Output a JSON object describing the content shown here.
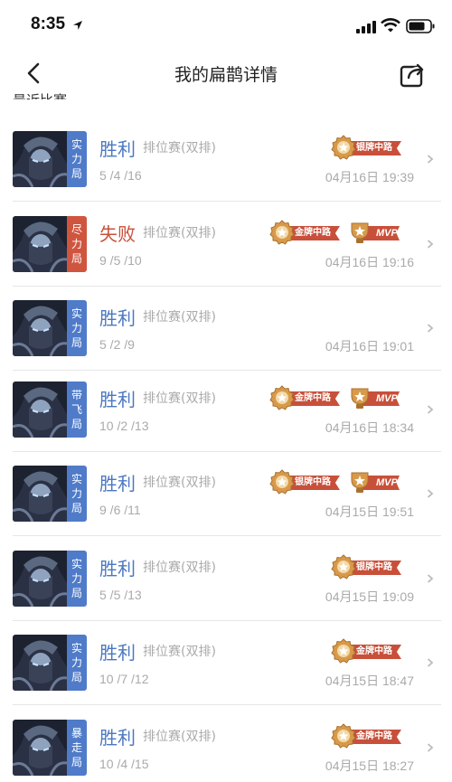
{
  "status_bar": {
    "time": "8:35"
  },
  "nav": {
    "title": "我的扁鹊详情"
  },
  "section_title": "最近比赛",
  "colors": {
    "win": "#4a78c2",
    "lose": "#c8503a",
    "tag_blue": "#4f7bc9",
    "tag_red": "#d0553f",
    "medal_gold": "#d89a4a",
    "ribbon": "#c8503a"
  },
  "matches": [
    {
      "tag_chars": [
        "实",
        "力",
        "局"
      ],
      "tag_color": "blue",
      "result": "胜利",
      "outcome": "win",
      "type": "排位赛(双排)",
      "kda": "5 /4 /16",
      "date": "04月16日 19:39",
      "badges": [
        {
          "label": "银牌中路",
          "kind": "medal"
        }
      ]
    },
    {
      "tag_chars": [
        "尽",
        "力",
        "局"
      ],
      "tag_color": "red",
      "result": "失败",
      "outcome": "lose",
      "type": "排位赛(双排)",
      "kda": "9 /5 /10",
      "date": "04月16日 19:16",
      "badges": [
        {
          "label": "金牌中路",
          "kind": "medal"
        },
        {
          "label": "MVP",
          "kind": "mvp"
        }
      ]
    },
    {
      "tag_chars": [
        "实",
        "力",
        "局"
      ],
      "tag_color": "blue",
      "result": "胜利",
      "outcome": "win",
      "type": "排位赛(双排)",
      "kda": "5 /2 /9",
      "date": "04月16日 19:01",
      "badges": []
    },
    {
      "tag_chars": [
        "带",
        "飞",
        "局"
      ],
      "tag_color": "blue",
      "result": "胜利",
      "outcome": "win",
      "type": "排位赛(双排)",
      "kda": "10 /2 /13",
      "date": "04月16日 18:34",
      "badges": [
        {
          "label": "金牌中路",
          "kind": "medal"
        },
        {
          "label": "MVP",
          "kind": "mvp"
        }
      ]
    },
    {
      "tag_chars": [
        "实",
        "力",
        "局"
      ],
      "tag_color": "blue",
      "result": "胜利",
      "outcome": "win",
      "type": "排位赛(双排)",
      "kda": "9 /6 /11",
      "date": "04月15日 19:51",
      "badges": [
        {
          "label": "银牌中路",
          "kind": "medal"
        },
        {
          "label": "MVP",
          "kind": "mvp"
        }
      ]
    },
    {
      "tag_chars": [
        "实",
        "力",
        "局"
      ],
      "tag_color": "blue",
      "result": "胜利",
      "outcome": "win",
      "type": "排位赛(双排)",
      "kda": "5 /5 /13",
      "date": "04月15日 19:09",
      "badges": [
        {
          "label": "银牌中路",
          "kind": "medal"
        }
      ]
    },
    {
      "tag_chars": [
        "实",
        "力",
        "局"
      ],
      "tag_color": "blue",
      "result": "胜利",
      "outcome": "win",
      "type": "排位赛(双排)",
      "kda": "10 /7 /12",
      "date": "04月15日 18:47",
      "badges": [
        {
          "label": "金牌中路",
          "kind": "medal"
        }
      ]
    },
    {
      "tag_chars": [
        "暴",
        "走",
        "局"
      ],
      "tag_color": "blue",
      "result": "胜利",
      "outcome": "win",
      "type": "排位赛(双排)",
      "kda": "10 /4 /15",
      "date": "04月15日 18:27",
      "badges": [
        {
          "label": "金牌中路",
          "kind": "medal"
        }
      ]
    }
  ]
}
